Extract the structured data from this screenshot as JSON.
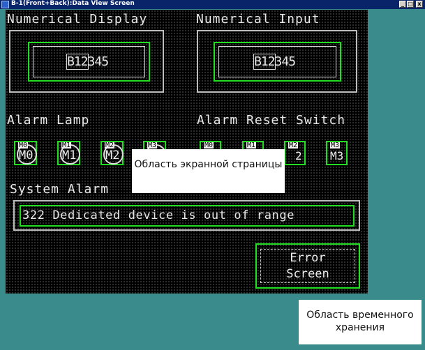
{
  "window": {
    "title": "B-1(Front+Back):Data View Screen",
    "controls": {
      "minimize": "_",
      "restore": "□",
      "close": "x"
    }
  },
  "numerical_display": {
    "label": "Numerical Display",
    "device_tag": "B12",
    "value": "345"
  },
  "numerical_input": {
    "label": "Numerical Input",
    "device_tag": "B12",
    "value": "345"
  },
  "alarm_lamp": {
    "label": "Alarm Lamp",
    "lamps": [
      {
        "tag": "M0",
        "caption": "M0"
      },
      {
        "tag": "M1",
        "caption": "M1"
      },
      {
        "tag": "M2",
        "caption": "M2"
      },
      {
        "tag": "M3",
        "caption": ""
      }
    ]
  },
  "alarm_reset_switch": {
    "label": "Alarm Reset Switch",
    "switches": [
      {
        "tag": "M0",
        "caption": ""
      },
      {
        "tag": "M1",
        "caption": ""
      },
      {
        "tag": "M2",
        "caption": "2"
      },
      {
        "tag": "M3",
        "caption": "M3"
      }
    ]
  },
  "system_alarm": {
    "label": "System Alarm",
    "message": "322 Dedicated device is out of range"
  },
  "error_screen_button": {
    "line1": "Error",
    "line2": "Screen"
  },
  "callouts": {
    "screen_area": "Область экранной страницы",
    "storage_area": "Область временного хранения"
  },
  "colors": {
    "background": "#3a8c8c",
    "screen": "#000000",
    "accent": "#22dd22",
    "titlebar": "#0a246a"
  }
}
